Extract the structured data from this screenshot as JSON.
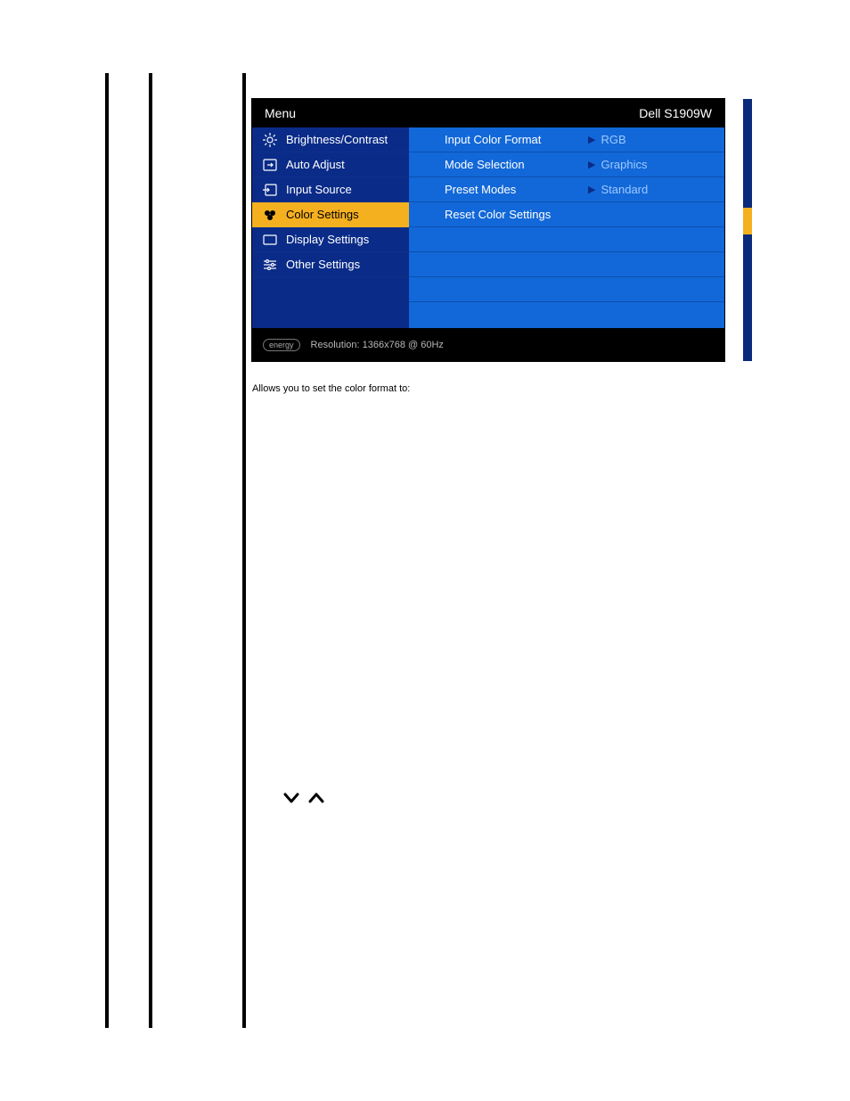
{
  "osd": {
    "header": {
      "title": "Menu",
      "model": "Dell S1909W"
    },
    "left_items": [
      {
        "label": "Brightness/Contrast",
        "icon": "brightness-icon",
        "selected": false
      },
      {
        "label": "Auto Adjust",
        "icon": "auto-adjust-icon",
        "selected": false
      },
      {
        "label": "Input Source",
        "icon": "input-source-icon",
        "selected": false
      },
      {
        "label": "Color Settings",
        "icon": "color-settings-icon",
        "selected": true
      },
      {
        "label": "Display Settings",
        "icon": "display-settings-icon",
        "selected": false
      },
      {
        "label": "Other Settings",
        "icon": "other-settings-icon",
        "selected": false
      }
    ],
    "right_items": [
      {
        "label": "Input Color Format",
        "value": "RGB"
      },
      {
        "label": "Mode Selection",
        "value": "Graphics"
      },
      {
        "label": "Preset Modes",
        "value": "Standard"
      },
      {
        "label": "Reset Color Settings",
        "value": ""
      }
    ],
    "footer": {
      "resolution": "Resolution: 1366x768 @ 60Hz"
    }
  },
  "caption": "Allows you to set the color format to:"
}
